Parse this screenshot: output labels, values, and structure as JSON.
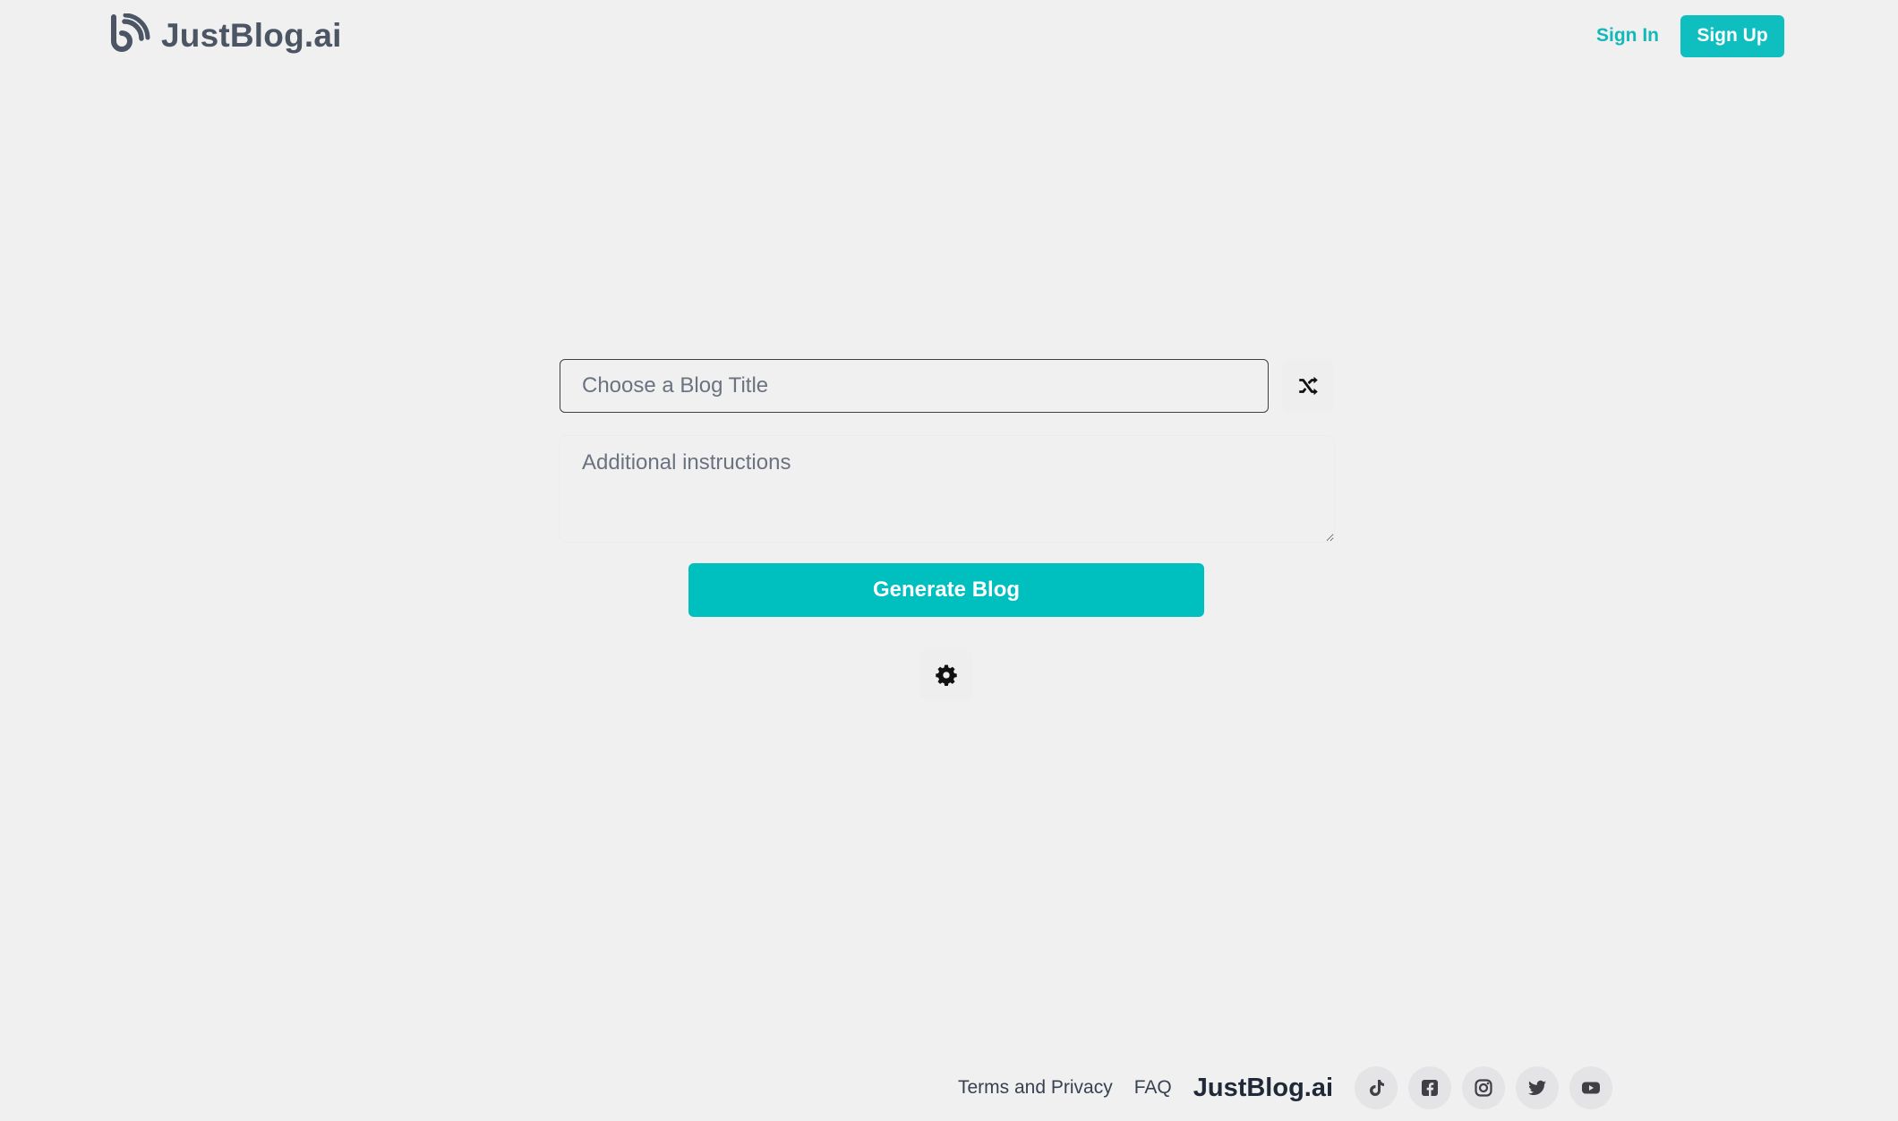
{
  "header": {
    "brand_name": "JustBlog.ai",
    "logo_icon": "blog-logo-icon",
    "sign_in_label": "Sign In",
    "sign_up_label": "Sign Up",
    "accent_color": "#00bfbf"
  },
  "main": {
    "title_placeholder": "Choose a Blog Title",
    "title_value": "",
    "shuffle_icon": "shuffle-icon",
    "instructions_placeholder": "Additional instructions",
    "instructions_value": "",
    "generate_label": "Generate Blog",
    "settings_icon": "gear-icon"
  },
  "footer": {
    "terms_label": "Terms and Privacy",
    "faq_label": "FAQ",
    "brand_name": "JustBlog.ai",
    "social_icons": [
      "tiktok-icon",
      "facebook-icon",
      "instagram-icon",
      "twitter-icon",
      "youtube-icon"
    ]
  }
}
